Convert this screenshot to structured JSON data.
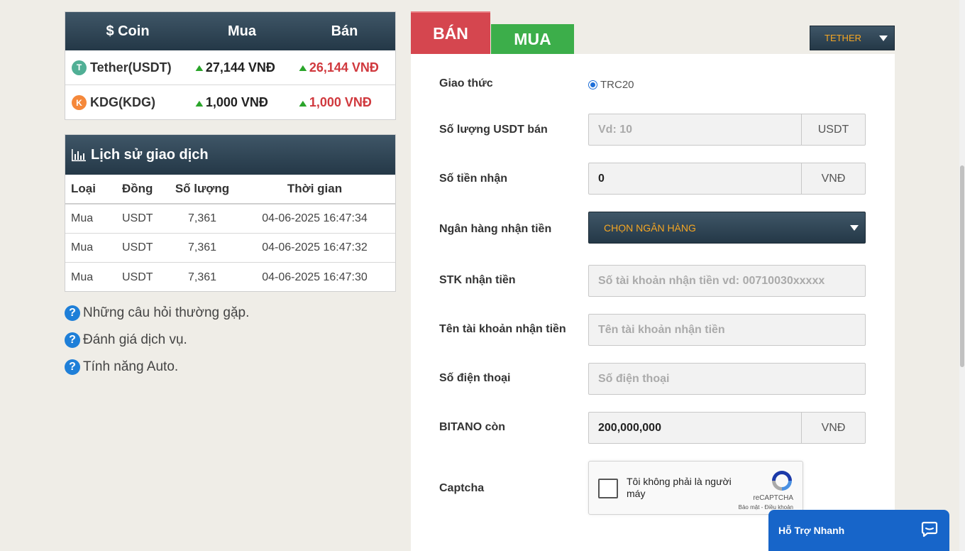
{
  "price_table": {
    "headers": [
      "$ Coin",
      "Mua",
      "Bán"
    ],
    "rows": [
      {
        "coin": "Tether(USDT)",
        "icon": "tether-icon",
        "buy": "27,144 VNĐ",
        "sell": "26,144 VNĐ"
      },
      {
        "coin": "KDG(KDG)",
        "icon": "kdg-icon",
        "buy": "1,000 VNĐ",
        "sell": "1,000 VNĐ"
      }
    ]
  },
  "history": {
    "title": "Lịch sử giao dịch",
    "columns": [
      "Loại",
      "Đồng",
      "Số lượng",
      "Thời gian"
    ],
    "rows": [
      {
        "type": "Mua",
        "coin": "USDT",
        "amount": "7,361",
        "time": "04-06-2025 16:47:34"
      },
      {
        "type": "Mua",
        "coin": "USDT",
        "amount": "7,361",
        "time": "04-06-2025 16:47:32"
      },
      {
        "type": "Mua",
        "coin": "USDT",
        "amount": "7,361",
        "time": "04-06-2025 16:47:30"
      }
    ]
  },
  "faq_links": [
    "Những câu hỏi thường gặp.",
    "Đánh giá dịch vụ.",
    "Tính năng Auto."
  ],
  "tabs": {
    "sell": "BÁN",
    "buy": "MUA"
  },
  "coin_select": "TETHER",
  "form": {
    "protocol_label": "Giao thức",
    "protocol_value": "TRC20",
    "amount_label": "Số lượng USDT bán",
    "amount_placeholder": "Vd: 10",
    "amount_unit": "USDT",
    "receive_label": "Số tiền nhận",
    "receive_value": "0",
    "receive_unit": "VNĐ",
    "bank_label": "Ngân hàng nhận tiền",
    "bank_select": "CHỌN NGÂN HÀNG",
    "account_no_label": "STK nhận tiền",
    "account_no_placeholder": "Số tài khoản nhận tiền vd: 00710030xxxxx",
    "account_name_label": "Tên tài khoản nhận tiền",
    "account_name_placeholder": "Tên tài khoản nhận tiền",
    "phone_label": "Số điện thoại",
    "phone_placeholder": "Số điện thoại",
    "balance_label": "BITANO còn",
    "balance_value": "200,000,000",
    "balance_unit": "VNĐ",
    "captcha_label": "Captcha"
  },
  "captcha": {
    "text": "Tôi không phải là người máy",
    "brand": "reCAPTCHA",
    "links": "Bảo mật - Điều khoản"
  },
  "support": {
    "label": "Hỗ Trợ Nhanh"
  },
  "colors": {
    "header_dark": "#243847",
    "sell_red": "#d5464f",
    "buy_green": "#3cae4a",
    "accent_orange": "#f5a623",
    "support_blue": "#1765c9"
  }
}
